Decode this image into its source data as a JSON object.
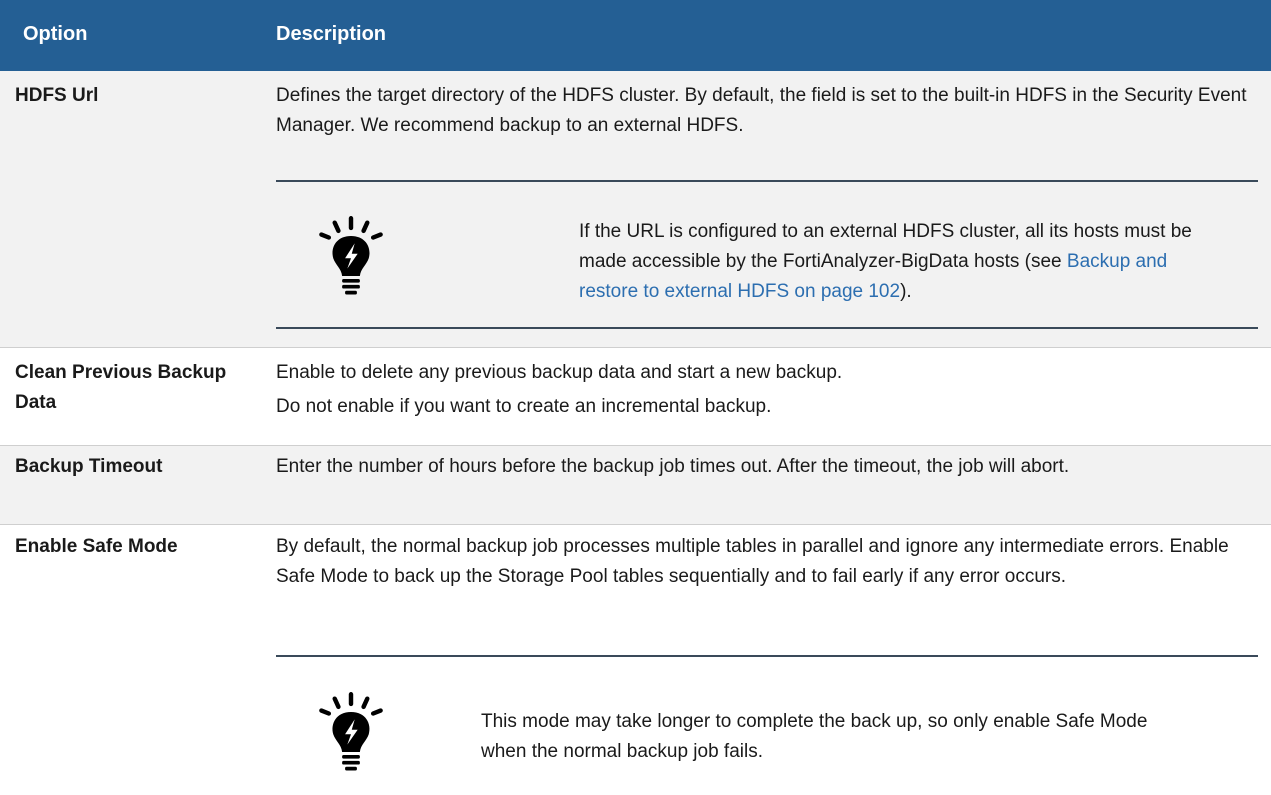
{
  "table": {
    "headers": {
      "option": "Option",
      "description": "Description"
    },
    "rows": [
      {
        "option": "HDFS Url",
        "description": "Defines the target directory of the HDFS cluster. By default, the field is set to the built-in HDFS in the Security Event Manager. We recommend backup to an external HDFS.",
        "note": {
          "icon": "lightbulb-tip-icon",
          "text_before": "If the URL is configured to an external HDFS cluster, all its hosts must be made accessible by the FortiAnalyzer-BigData hosts (see ",
          "link": "Backup and restore to external HDFS on page 102",
          "text_after": ")."
        }
      },
      {
        "option": "Clean Previous Backup Data",
        "description_lines": [
          "Enable to delete any previous backup data and start a new backup.",
          "Do not enable if you want to create an incremental backup."
        ]
      },
      {
        "option": "Backup Timeout",
        "description": "Enter the number of hours before the backup job times out. After the timeout, the job will abort."
      },
      {
        "option": "Enable Safe Mode",
        "description": "By default, the normal backup job processes multiple tables in parallel and ignore any intermediate errors. Enable Safe Mode to back up the Storage Pool tables sequentially and to fail early if any error occurs.",
        "note": {
          "icon": "lightbulb-tip-icon",
          "text": "This mode may take longer to complete the back up, so only enable Safe Mode when the normal backup job fails."
        }
      }
    ]
  },
  "colors": {
    "header_bg": "#245f94",
    "link": "#2c6eb0",
    "shaded_row": "#f2f2f2"
  }
}
